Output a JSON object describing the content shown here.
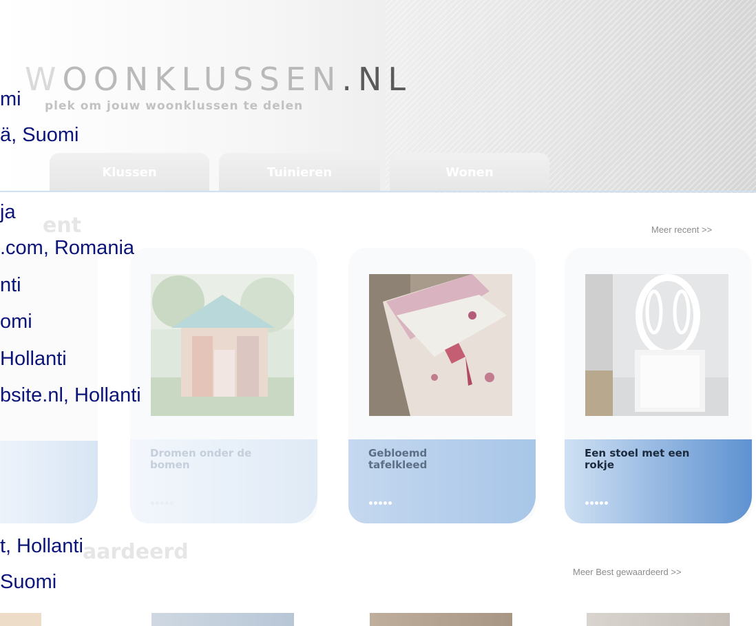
{
  "header": {
    "logo_dim": "W",
    "logo_main": "OONKLUSSEN",
    "logo_dark": ".NL",
    "tagline": "plek om jouw woonklussen te delen"
  },
  "tabs": [
    "Klussen",
    "Tuinieren",
    "Wonen"
  ],
  "overlay_lines": [
    "mi",
    "ä, Suomi",
    "ja",
    ".com, Romania",
    "nti",
    "omi",
    " Hollanti",
    "bsite.nl, Hollanti",
    "t, Hollanti",
    " Suomi"
  ],
  "sections": {
    "recent": {
      "title_fragment": "ent",
      "more_link": "Meer recent >>"
    },
    "best": {
      "title_fragment": "aardeerd",
      "more_link": "Meer Best gewaardeerd >>"
    }
  },
  "cards": [
    {
      "title_line1": "Dromen onder de",
      "title_line2": "bomen",
      "rating_dots": 5
    },
    {
      "title_line1": "Gebloemd",
      "title_line2": "tafelkleed",
      "rating_dots": 5
    },
    {
      "title_line1": "Een stoel met een",
      "title_line2": "rokje",
      "rating_dots": 5
    }
  ],
  "colors": {
    "overlay_text": "#0b1478",
    "card_title_faded": "#c5cfdc",
    "card_title_mid": "#5d6f86",
    "card_title_active": "#1c2a3e",
    "caption_blue": "#5e92d1"
  }
}
